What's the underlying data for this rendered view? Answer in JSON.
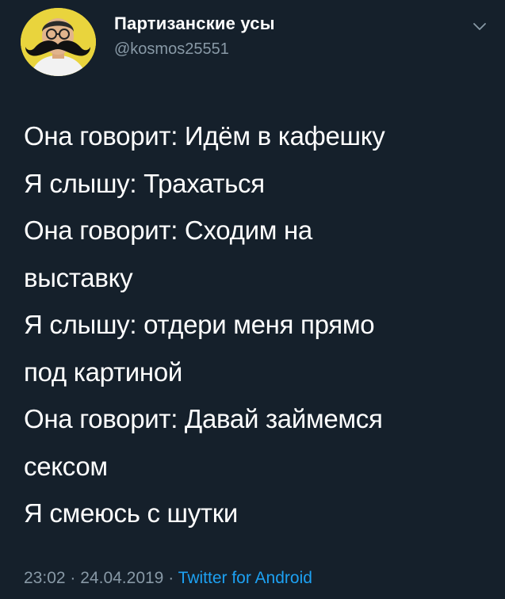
{
  "author": {
    "display_name": "Партизанские усы",
    "handle": "@kosmos25551"
  },
  "icons": {
    "avatar": "avatar-mustache-man",
    "menu": "chevron-down-icon"
  },
  "tweet": {
    "lines": [
      "Она говорит: Идём в кафешку",
      "Я слышу:  Трахаться",
      "Она говорит:  Сходим на",
      "выставку",
      "Я слышу:  отдери меня прямо",
      "под картиной",
      "Она говорит:  Давай займемся",
      "сексом",
      "Я смеюсь с шутки"
    ]
  },
  "meta": {
    "time": "23:02",
    "separator": "·",
    "date": "24.04.2019",
    "source": "Twitter for Android"
  },
  "colors": {
    "background": "#15202b",
    "text": "#ffffff",
    "secondary": "#8899a6",
    "link": "#1da1f2",
    "avatar_bg": "#e9d43d"
  }
}
